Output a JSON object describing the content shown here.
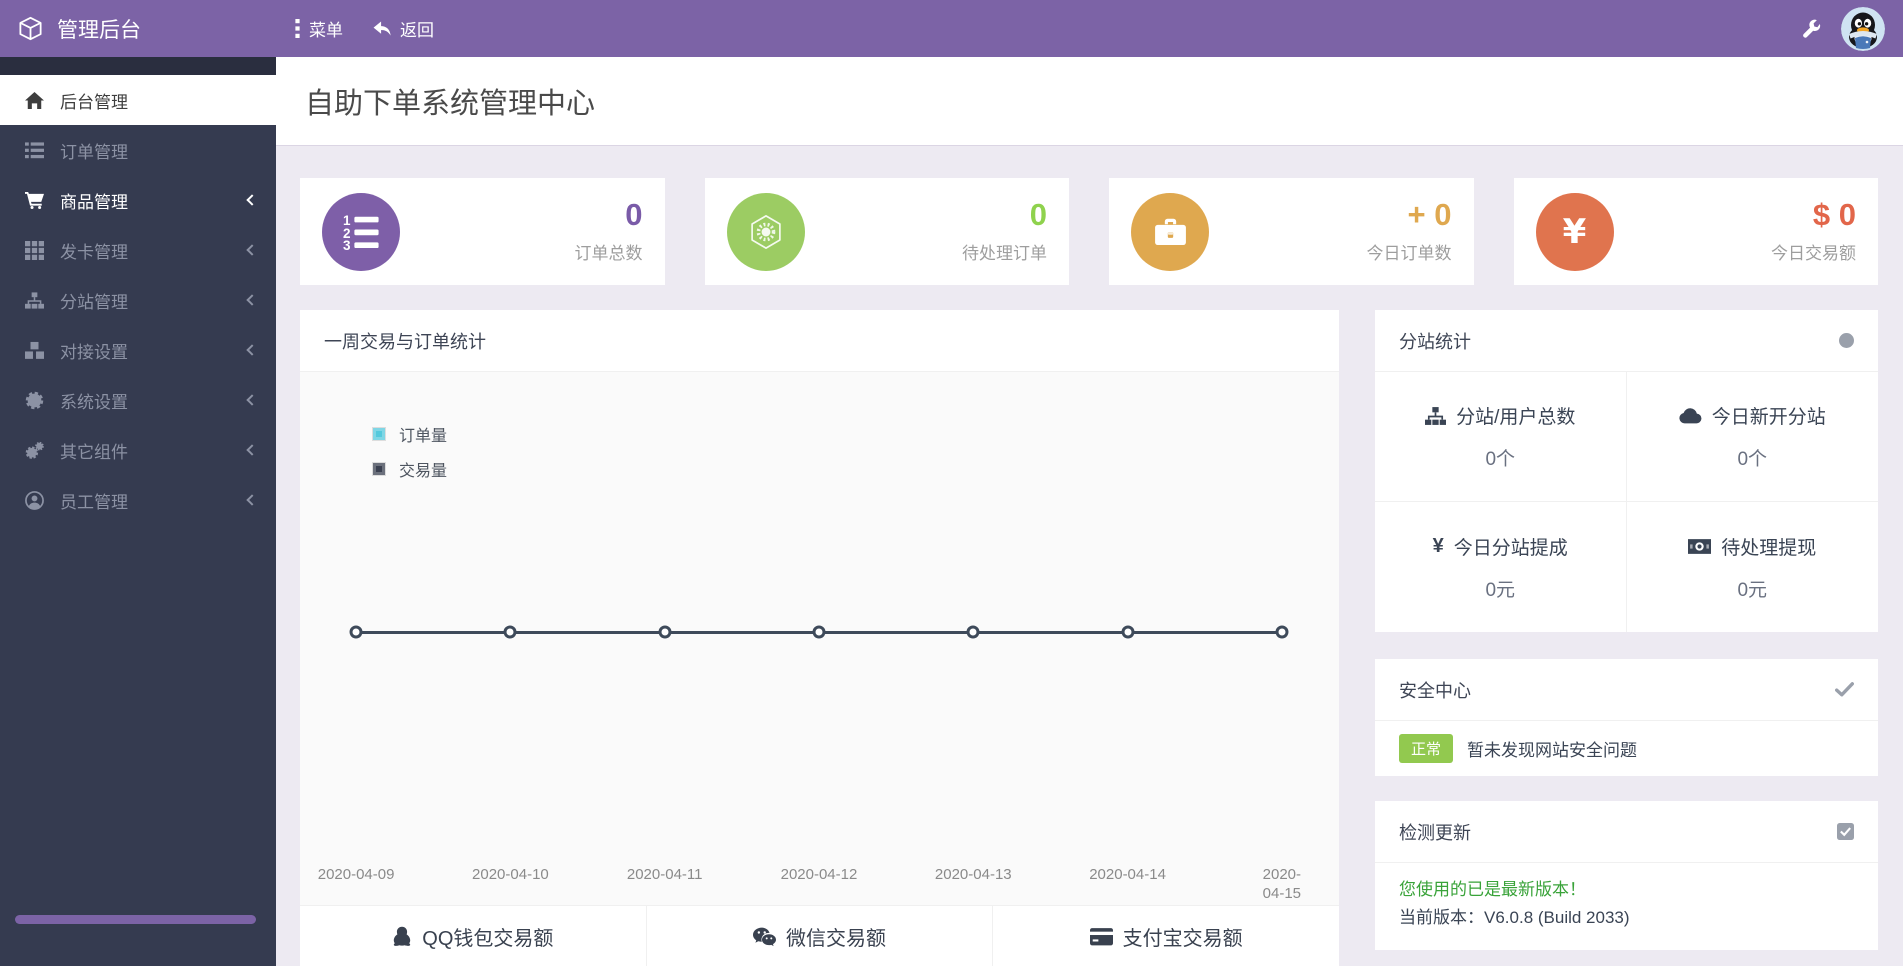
{
  "topbar": {
    "brand": {
      "icon": "cube-logo",
      "title": "管理后台"
    },
    "menu": {
      "icon": "menu-dots",
      "label": "菜单"
    },
    "back": {
      "icon": "reply-arrow",
      "label": "返回"
    }
  },
  "sidebar": {
    "items": [
      {
        "icon": "home",
        "label": "后台管理",
        "active": true,
        "bright": false,
        "chevron": false
      },
      {
        "icon": "list",
        "label": "订单管理",
        "active": false,
        "bright": false,
        "chevron": false
      },
      {
        "icon": "cart",
        "label": "商品管理",
        "active": false,
        "bright": true,
        "chevron": true
      },
      {
        "icon": "grid",
        "label": "发卡管理",
        "active": false,
        "bright": false,
        "chevron": true
      },
      {
        "icon": "sitemap",
        "label": "分站管理",
        "active": false,
        "bright": false,
        "chevron": true
      },
      {
        "icon": "cubes",
        "label": "对接设置",
        "active": false,
        "bright": false,
        "chevron": true
      },
      {
        "icon": "gear",
        "label": "系统设置",
        "active": false,
        "bright": false,
        "chevron": true
      },
      {
        "icon": "cogs",
        "label": "其它组件",
        "active": false,
        "bright": false,
        "chevron": true
      },
      {
        "icon": "user",
        "label": "员工管理",
        "active": false,
        "bright": false,
        "chevron": true
      }
    ]
  },
  "page": {
    "title": "自助下单系统管理中心"
  },
  "stats": {
    "cards": [
      {
        "icon": "list-ol",
        "circle_color": "#7E5FA8",
        "value": "0",
        "value_color": "#7A5BA8",
        "label": "订单总数"
      },
      {
        "icon": "hex-gear",
        "circle_color": "#9CCC63",
        "value": "0",
        "value_color": "#8FD24D",
        "label": "待处理订单"
      },
      {
        "icon": "briefcase",
        "circle_color": "#DFA84F",
        "value": "+ 0",
        "value_color": "#DFA84F",
        "label": "今日订单数"
      },
      {
        "icon": "yen",
        "circle_color": "#E0744E",
        "value": "$ 0",
        "value_color": "#E2664A",
        "label": "今日交易额"
      }
    ]
  },
  "chart": {
    "title": "一周交易与订单统计",
    "legend": [
      {
        "label": "订单量",
        "color": "#54C9DC"
      },
      {
        "label": "交易量",
        "color": "#3A4050"
      }
    ],
    "line_color": "#3E4A5A"
  },
  "chart_data": {
    "type": "line",
    "title": "一周交易与订单统计",
    "x": [
      "2020-04-09",
      "2020-04-10",
      "2020-04-11",
      "2020-04-12",
      "2020-04-13",
      "2020-04-14",
      "2020-04-15"
    ],
    "series": [
      {
        "name": "订单量",
        "color": "#54C9DC",
        "values": [
          0,
          0,
          0,
          0,
          0,
          0,
          0
        ]
      },
      {
        "name": "交易量",
        "color": "#3A4050",
        "values": [
          0,
          0,
          0,
          0,
          0,
          0,
          0
        ]
      }
    ],
    "legend_position": "top-left",
    "grid": false,
    "ylim": [
      0,
      1
    ]
  },
  "footer": {
    "items": [
      {
        "icon": "qq",
        "label": "QQ钱包交易额"
      },
      {
        "icon": "wechat",
        "label": "微信交易额"
      },
      {
        "icon": "alipay-card",
        "label": "支付宝交易额"
      }
    ]
  },
  "substation": {
    "title": "分站统计",
    "cells": [
      {
        "icon": "sitemap-dark",
        "label": "分站/用户总数",
        "value": "0个"
      },
      {
        "icon": "cloud",
        "label": "今日新开分站",
        "value": "0个"
      },
      {
        "icon": "yen-text",
        "label": "今日分站提成",
        "value": "0元"
      },
      {
        "icon": "money-bill",
        "label": "待处理提现",
        "value": "0元"
      }
    ]
  },
  "security": {
    "title": "安全中心",
    "badge": "正常",
    "badge_color": "#92C94F",
    "text": "暂未发现网站安全问题"
  },
  "update": {
    "title": "检测更新",
    "line1": "您使用的已是最新版本！",
    "line1_color": "#39A339",
    "line2": "当前版本：V6.0.8 (Build 2033)"
  }
}
